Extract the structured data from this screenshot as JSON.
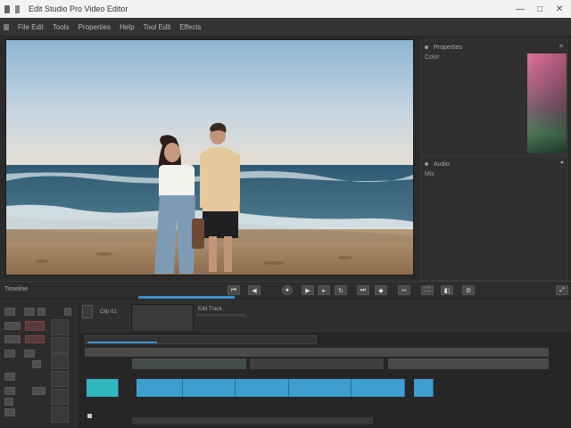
{
  "window": {
    "title": "Edit Studio Pro Video Editor",
    "minimize_label": "—",
    "maximize_label": "□",
    "close_label": "✕"
  },
  "menu": {
    "items": [
      "File  Edit",
      "Tools",
      "Properties",
      "Help",
      "Tool  Edit",
      "Effects"
    ]
  },
  "right_panel_top": {
    "title": "Properties",
    "sub": "Color"
  },
  "right_panel_bottom": {
    "title": "Audio",
    "sub": "Mix"
  },
  "transport": {
    "label": "Timeline"
  },
  "timeline": {
    "thumb_label": "Clip 01",
    "thumb_label2": "Edit Track"
  },
  "colors": {
    "accent_blue": "#3e9ed0",
    "accent_teal": "#32b6c0"
  }
}
